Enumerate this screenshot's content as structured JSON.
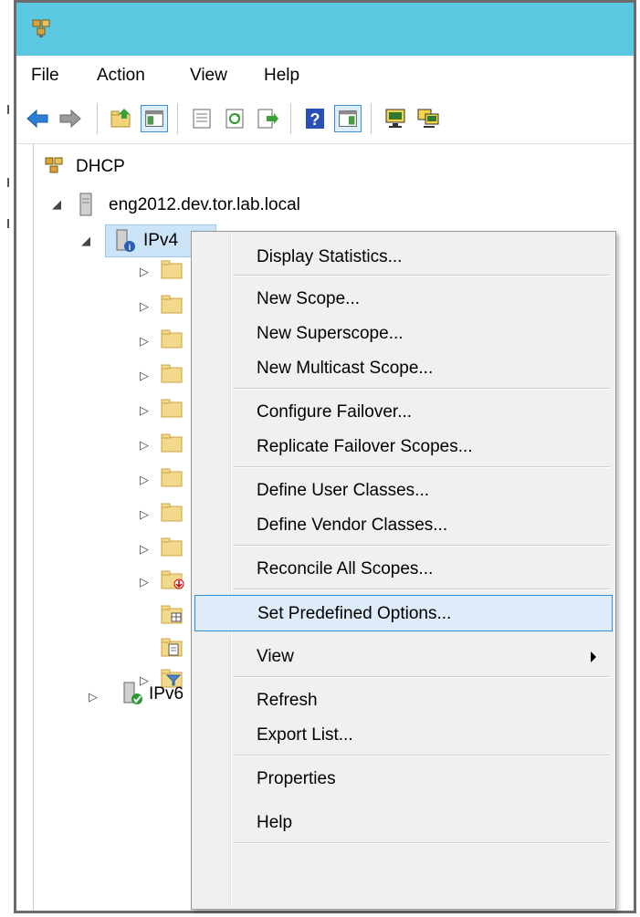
{
  "menubar": {
    "items": [
      "File",
      "Action",
      "View",
      "Help"
    ]
  },
  "toolbar": {
    "buttons": [
      {
        "icon": "back-arrow-icon"
      },
      {
        "icon": "forward-arrow-icon"
      },
      {
        "icon": "up-folder-icon"
      },
      {
        "icon": "show-hide-console-tree-icon"
      },
      {
        "icon": "properties-icon"
      },
      {
        "icon": "refresh-icon"
      },
      {
        "icon": "export-list-icon"
      },
      {
        "icon": "help-icon"
      },
      {
        "icon": "show-hide-action-pane-icon"
      },
      {
        "icon": "computer-monitor-icon"
      },
      {
        "icon": "computer-network-icon"
      }
    ]
  },
  "tree": {
    "root": "DHCP",
    "server": "eng2012.dev.tor.lab.local",
    "ipv4": "IPv4",
    "ipv6": "IPv6"
  },
  "context_menu": {
    "items": [
      "Display Statistics...",
      "New Scope...",
      "New Superscope...",
      "New Multicast Scope...",
      "Configure Failover...",
      "Replicate Failover Scopes...",
      "Define User Classes...",
      "Define Vendor Classes...",
      "Reconcile All Scopes...",
      "Set Predefined Options...",
      "View",
      "Refresh",
      "Export List...",
      "Properties",
      "Help"
    ],
    "highlighted": "Set Predefined Options..."
  },
  "colors": {
    "titlebar": "#5bc8e2",
    "menu_background": "#f0f0f0",
    "highlight_border": "#2f8fd8",
    "highlight_fill": "#ddecf8"
  }
}
